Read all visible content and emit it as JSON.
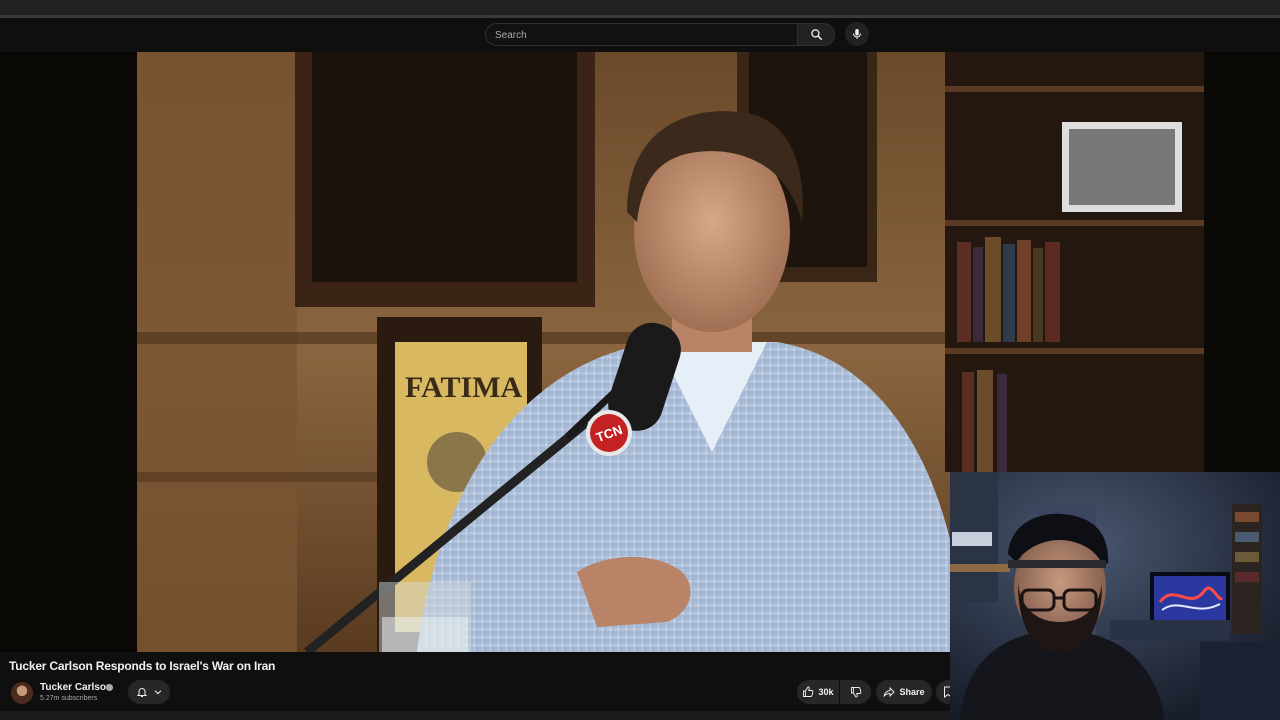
{
  "search": {
    "placeholder": "Search"
  },
  "icons": {
    "search": "search-icon",
    "mic": "mic-icon",
    "bell": "bell-icon",
    "chevron": "chevron-down-icon",
    "like": "thumbs-up-icon",
    "dislike": "thumbs-down-icon",
    "share": "share-icon",
    "save": "save-icon"
  },
  "video": {
    "title": "Tucker Carlson Responds to Israel's War on Iran",
    "mic_logo": "TCN",
    "poster_text": "FATIMA"
  },
  "channel": {
    "name": "Tucker Carlson",
    "subscribers": "5.27m subscribers"
  },
  "actions": {
    "like_count": "30k",
    "share_label": "Share"
  },
  "colors": {
    "background": "#0f0f0f",
    "button_bg": "#272727",
    "text_primary": "#f1f1f1",
    "text_secondary": "#aaaaaa"
  }
}
